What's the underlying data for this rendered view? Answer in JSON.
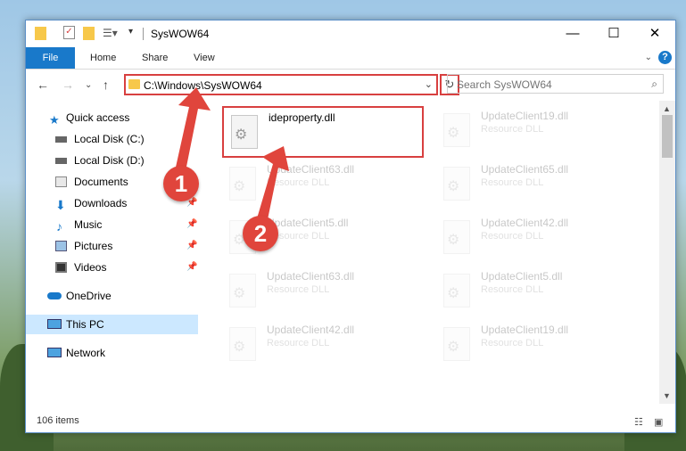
{
  "window": {
    "title": "SysWOW64"
  },
  "ribbon": {
    "file": "File",
    "tabs": [
      "Home",
      "Share",
      "View"
    ]
  },
  "address": {
    "path": "C:\\Windows\\SysWOW64"
  },
  "search": {
    "placeholder": "Search SysWOW64"
  },
  "nav": {
    "items": [
      {
        "label": "Quick access",
        "icon": "star-icon"
      },
      {
        "label": "Local Disk (C:)",
        "icon": "drive-icon"
      },
      {
        "label": "Local Disk (D:)",
        "icon": "drive-icon"
      },
      {
        "label": "Documents",
        "icon": "documents-icon"
      },
      {
        "label": "Downloads",
        "icon": "download-icon"
      },
      {
        "label": "Music",
        "icon": "music-icon"
      },
      {
        "label": "Pictures",
        "icon": "pictures-icon"
      },
      {
        "label": "Videos",
        "icon": "videos-icon"
      },
      {
        "label": "OneDrive",
        "icon": "cloud-icon"
      },
      {
        "label": "This PC",
        "icon": "computer-icon"
      },
      {
        "label": "Network",
        "icon": "network-icon"
      }
    ]
  },
  "files": [
    {
      "name": "ideproperty.dll",
      "type": ""
    },
    {
      "name": "UpdateClient19.dll",
      "type": "Resource DLL"
    },
    {
      "name": "UpdateClient63.dll",
      "type": "Resource DLL"
    },
    {
      "name": "UpdateClient65.dll",
      "type": "Resource DLL"
    },
    {
      "name": "UpdateClient5.dll",
      "type": "Resource DLL"
    },
    {
      "name": "UpdateClient42.dll",
      "type": "Resource DLL"
    },
    {
      "name": "UpdateClient63.dll",
      "type": "Resource DLL"
    },
    {
      "name": "UpdateClient5.dll",
      "type": "Resource DLL"
    },
    {
      "name": "UpdateClient42.dll",
      "type": "Resource DLL"
    },
    {
      "name": "UpdateClient19.dll",
      "type": "Resource DLL"
    }
  ],
  "status": {
    "count": "106 items"
  },
  "annotations": {
    "step1": "1",
    "step2": "2"
  },
  "colors": {
    "accent": "#1979ca",
    "highlight": "#d84040",
    "selected": "#cce8ff"
  }
}
